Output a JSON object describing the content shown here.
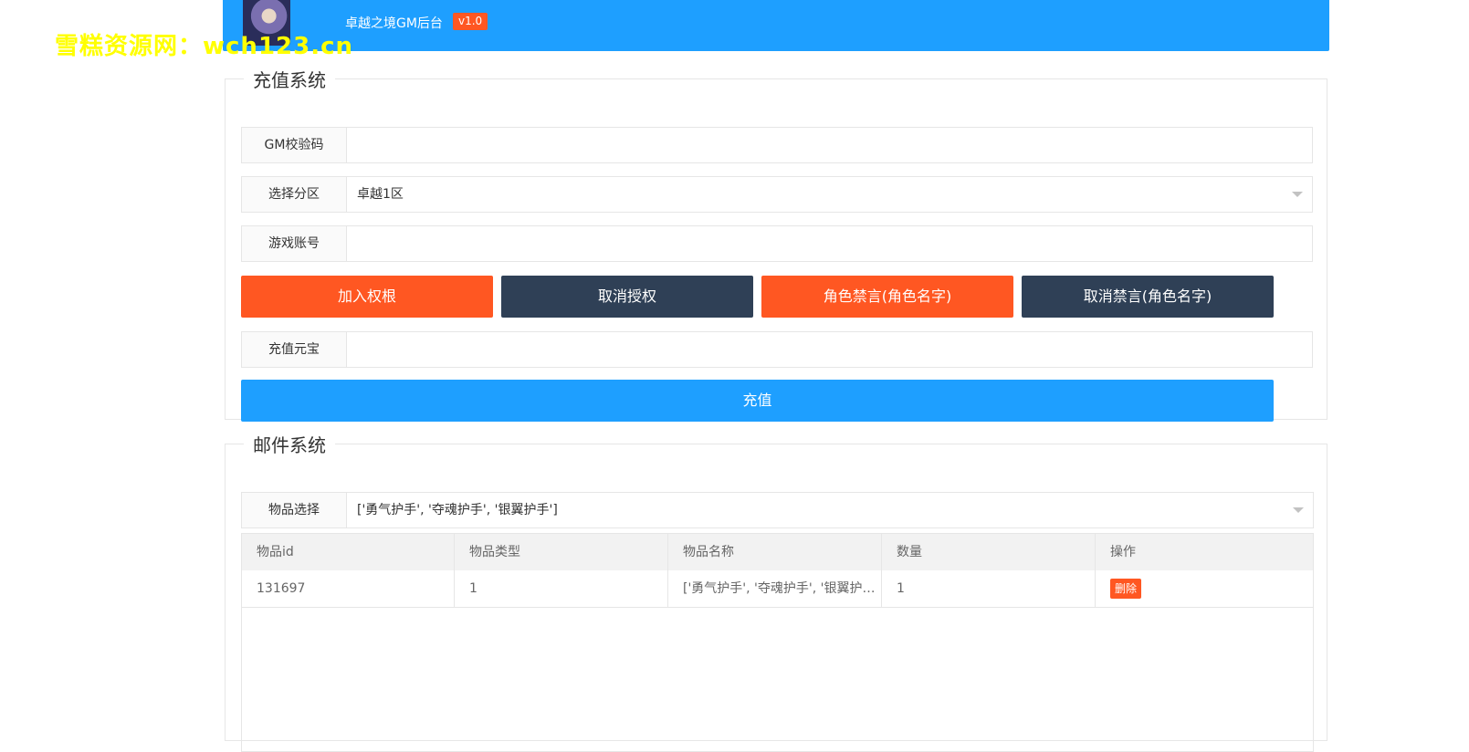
{
  "watermark": "雪糕资源网：wch123.cn",
  "header": {
    "title": "卓越之境GM后台",
    "version": "v1.0"
  },
  "recharge": {
    "legend": "充值系统",
    "gm_code_label": "GM校验码",
    "gm_code_value": "",
    "server_label": "选择分区",
    "server_value": "卓越1区",
    "account_label": "游戏账号",
    "account_value": "",
    "buttons": {
      "add_auth": "加入权根",
      "cancel_auth": "取消授权",
      "mute_role": "角色禁言(角色名字)",
      "unmute_role": "取消禁言(角色名字)"
    },
    "yuanbao_label": "充值元宝",
    "yuanbao_value": "",
    "submit_label": "充值"
  },
  "mail": {
    "legend": "邮件系统",
    "item_select_label": "物品选择",
    "item_select_value": "['勇气护手', '夺魂护手', '银翼护手']",
    "table": {
      "headers": [
        "物品id",
        "物品类型",
        "物品名称",
        "数量",
        "操作"
      ],
      "rows": [
        {
          "id": "131697",
          "type": "1",
          "name": "['勇气护手', '夺魂护手', '银翼护手']",
          "qty": "1",
          "action": "删除"
        }
      ]
    }
  },
  "colors": {
    "primary": "#1e9fff",
    "warning": "#ff5722",
    "dark": "#2f4056",
    "watermark": "#ffff00"
  }
}
